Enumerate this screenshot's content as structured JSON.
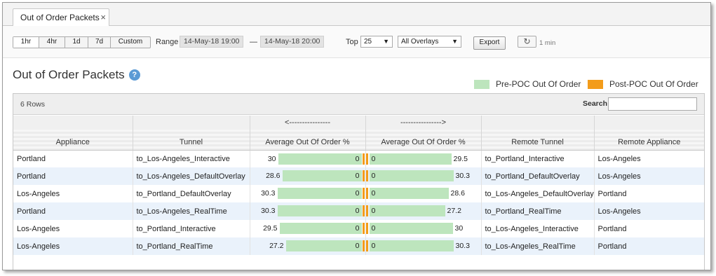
{
  "tab": {
    "title": "Out of Order Packets",
    "close": "×"
  },
  "toolbar": {
    "ranges": [
      "1hr",
      "4hr",
      "1d",
      "7d",
      "Custom"
    ],
    "range_label": "Range",
    "from": "14-May-18 19:00",
    "dash": "—",
    "to": "14-May-18 20:00",
    "top_label": "Top",
    "top_value": "25",
    "overlay_value": "All Overlays",
    "export_label": "Export",
    "refresh_icon": "refresh-icon",
    "refresh_interval": "1 min"
  },
  "page": {
    "title": "Out of Order Packets",
    "help": "?"
  },
  "legend": {
    "pre": {
      "label": "Pre-POC Out Of Order",
      "color": "#bde5bd"
    },
    "post": {
      "label": "Post-POC Out Of Order",
      "color": "#f39c1a"
    }
  },
  "grid": {
    "row_count": "6 Rows",
    "search_label": "Search",
    "arrow_left": "<----------------",
    "arrow_right": "---------------->",
    "columns": [
      "Appliance",
      "Tunnel",
      "Average Out Of Order %",
      "Average Out Of Order %",
      "Remote Tunnel",
      "Remote Appliance"
    ],
    "rows": [
      {
        "appliance": "Portland",
        "tunnel": "to_Los-Angeles_Interactive",
        "left_pre": "30",
        "left_post": "0",
        "right_post": "0",
        "right_pre": "29.5",
        "remote_tunnel": "to_Portland_Interactive",
        "remote_appliance": "Los-Angeles"
      },
      {
        "appliance": "Portland",
        "tunnel": "to_Los-Angeles_DefaultOverlay",
        "left_pre": "28.6",
        "left_post": "0",
        "right_post": "0",
        "right_pre": "30.3",
        "remote_tunnel": "to_Portland_DefaultOverlay",
        "remote_appliance": "Los-Angeles"
      },
      {
        "appliance": "Los-Angeles",
        "tunnel": "to_Portland_DefaultOverlay",
        "left_pre": "30.3",
        "left_post": "0",
        "right_post": "0",
        "right_pre": "28.6",
        "remote_tunnel": "to_Los-Angeles_DefaultOverlay",
        "remote_appliance": "Portland"
      },
      {
        "appliance": "Portland",
        "tunnel": "to_Los-Angeles_RealTime",
        "left_pre": "30.3",
        "left_post": "0",
        "right_post": "0",
        "right_pre": "27.2",
        "remote_tunnel": "to_Portland_RealTime",
        "remote_appliance": "Los-Angeles"
      },
      {
        "appliance": "Los-Angeles",
        "tunnel": "to_Portland_Interactive",
        "left_pre": "29.5",
        "left_post": "0",
        "right_post": "0",
        "right_pre": "30",
        "remote_tunnel": "to_Los-Angeles_Interactive",
        "remote_appliance": "Portland"
      },
      {
        "appliance": "Los-Angeles",
        "tunnel": "to_Portland_RealTime",
        "left_pre": "27.2",
        "left_post": "0",
        "right_post": "0",
        "right_pre": "30.3",
        "remote_tunnel": "to_Los-Angeles_RealTime",
        "remote_appliance": "Portland"
      }
    ]
  }
}
